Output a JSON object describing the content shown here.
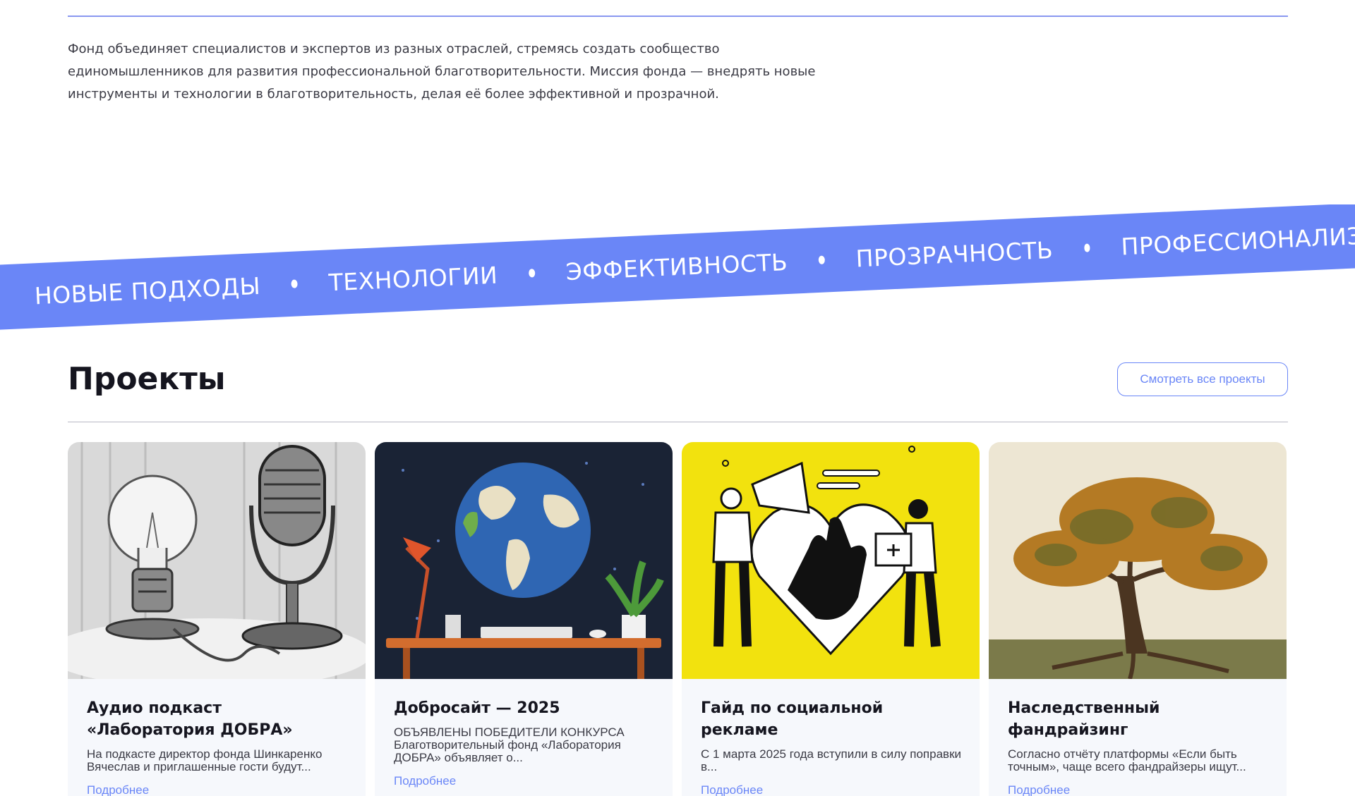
{
  "about": {
    "mission_text": "Фонд объединяет специалистов и экспертов из разных отраслей, стремясь создать сообщество единомышленников для развития профессиональной благотворительности. Миссия фонда — внедрять новые инструменты и технологии в благотворительность, делая её более эффективной и прозрачной."
  },
  "ribbon": {
    "items": [
      "НОВЫЕ ПОДХОДЫ",
      "ТЕХНОЛОГИИ",
      "ЭФФЕКТИВНОСТЬ",
      "ПРОЗРАЧНОСТЬ",
      "ПРОФЕССИОНАЛИЗМ"
    ],
    "color": "#6a86f7"
  },
  "projects": {
    "title": "Проекты",
    "all_button": "Смотреть все проекты",
    "cards": [
      {
        "title": "Аудио подкаст «Лаборатория ДОБРА»",
        "excerpt": "На подкасте директор фонда Шинкаренко Вячеслав и приглашенные гости будут...",
        "more": "Подробнее",
        "image": "lightbulb-and-microphone-sketch"
      },
      {
        "title": "Добросайт — 2025",
        "excerpt": "ОБЪЯВЛЕНЫ ПОБЕДИТЕЛИ КОНКУРСА Благотворительный фонд «Лаборатория ДОБРА»  объявляет о...",
        "more": "Подробнее",
        "image": "globe-over-desk-illustration"
      },
      {
        "title": "Гайд по социальной рекламе",
        "excerpt": "С 1 марта 2025 года вступили в силу поправки в...",
        "more": "Подробнее",
        "image": "megaphone-heart-hand-illustration"
      },
      {
        "title": "Наследственный фандрайзинг",
        "excerpt": "Согласно отчёту платформы «Если быть точным», чаще всего фандрайзеры ищут...",
        "more": "Подробнее",
        "image": "autumn-tree-painting"
      }
    ]
  },
  "colors": {
    "accent": "#6a86f7",
    "yellow": "#f2e20e",
    "text": "#1d1d2b"
  }
}
